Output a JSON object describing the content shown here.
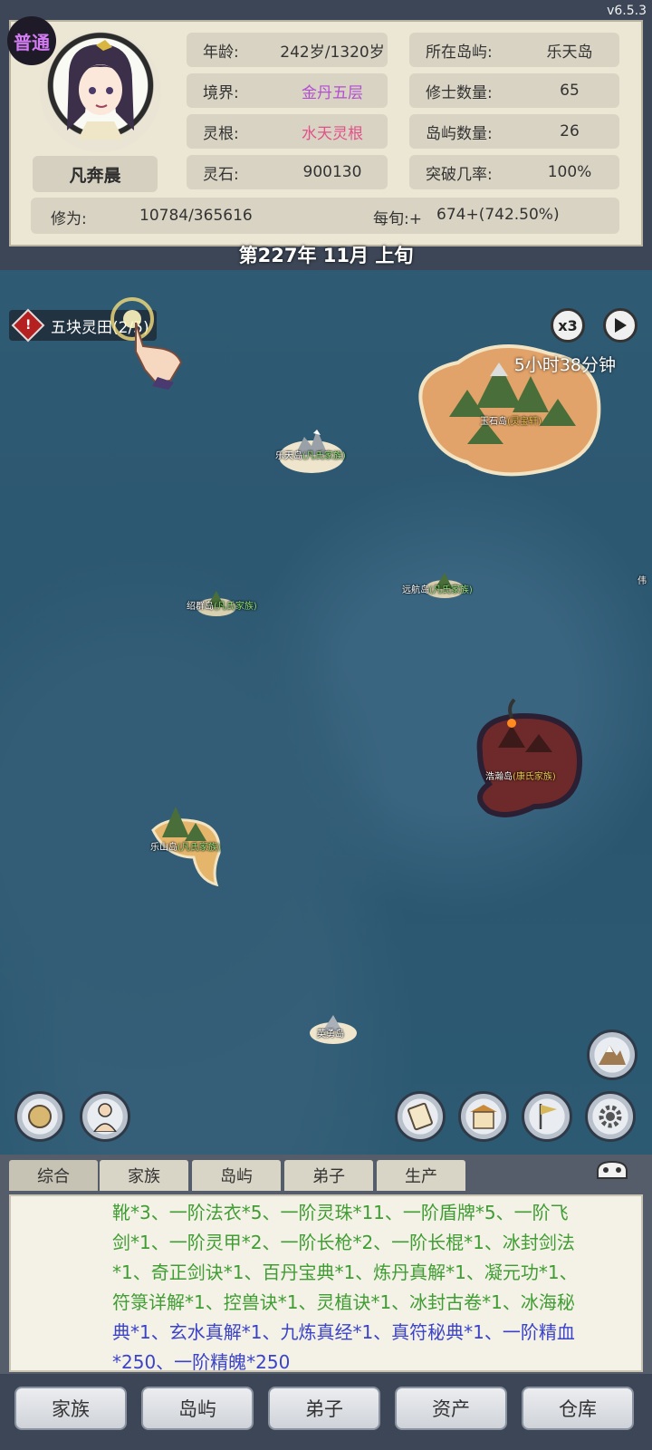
{
  "version": "v6.5.3",
  "badge": "普通",
  "character": {
    "name": "凡奔晨",
    "age_label": "年龄:",
    "age_value": "242岁/1320岁",
    "realm_label": "境界:",
    "realm_value": "金丹五层",
    "realm_color": "#b24fd0",
    "root_label": "灵根:",
    "root_value": "水天灵根",
    "root_color": "#e0538a",
    "stone_label": "灵石:",
    "stone_value": "900130",
    "island_label": "所在岛屿:",
    "island_value": "乐天岛",
    "cultivators_label": "修士数量:",
    "cultivators_value": "65",
    "islands_label": "岛屿数量:",
    "islands_value": "26",
    "breakthrough_label": "突破几率:",
    "breakthrough_value": "100%",
    "xiuwei_label": "修为:",
    "xiuwei_value": "10784/365616",
    "per_label": "每旬:+",
    "per_value": "674+(742.50%)"
  },
  "date": "第227年 11月 上旬",
  "quest": {
    "text": "五块灵田(2/5)"
  },
  "speed": {
    "multiplier": "x3",
    "timer": "5小时38分钟"
  },
  "islands": [
    {
      "name": "玉石岛",
      "family": "(灵宝轩)"
    },
    {
      "name": "乐天岛",
      "family": "(凡氏家族)"
    },
    {
      "name": "绍群岛",
      "family": "(凡氏家族)"
    },
    {
      "name": "远航岛",
      "family": "(凡氏家族)"
    },
    {
      "name": "伟",
      "family": ""
    },
    {
      "name": "浩瀚岛",
      "family": "(康氏家族)"
    },
    {
      "name": "乐山岛",
      "family": "(凡氏家族)"
    },
    {
      "name": "英勇岛",
      "family": ""
    }
  ],
  "log_tabs": [
    "综合",
    "家族",
    "岛屿",
    "弟子",
    "生产"
  ],
  "log_lines": {
    "l1": "靴*3、一阶法衣*5、一阶灵珠*11、一阶盾牌*5、一阶飞",
    "l2": "剑*1、一阶灵甲*2、一阶长枪*2、一阶长棍*1、冰封剑法",
    "l3a": "*1、奇正剑诀*1、百丹宝典*1、炼丹真解*1、凝元功*1、",
    "l4": "符箓详解*1、控兽诀*1、灵植诀*1、冰封古卷*1、冰海秘",
    "l5": "典*1、玄水真解*1、九炼真经*1、真符秘典*1、一阶精血",
    "l6": "*250、一阶精魄*250"
  },
  "nav": [
    "家族",
    "岛屿",
    "弟子",
    "资产",
    "仓库"
  ]
}
